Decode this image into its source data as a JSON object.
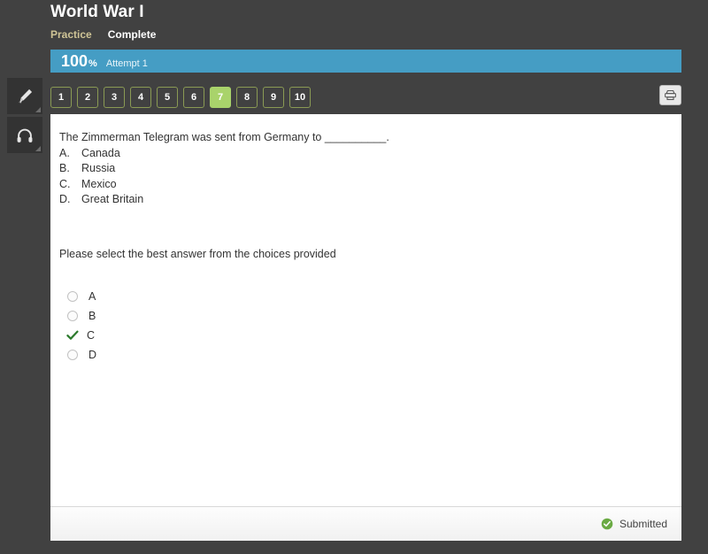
{
  "header": {
    "course_title": "World War I",
    "nav": {
      "practice_label": "Practice",
      "complete_label": "Complete"
    },
    "progress": {
      "score": "100",
      "percent_symbol": "%",
      "attempt_label": "Attempt 1"
    }
  },
  "tools": {
    "highlighter_icon": "highlighter-icon",
    "headphones_icon": "headphones-icon"
  },
  "question_nav": {
    "numbers": [
      "1",
      "2",
      "3",
      "4",
      "5",
      "6",
      "7",
      "8",
      "9",
      "10"
    ],
    "active_index": 6,
    "print_icon": "printer-icon"
  },
  "question": {
    "stem": "The Zimmerman Telegram was sent from Germany to __________.",
    "choices": [
      {
        "letter": "A.",
        "text": "Canada"
      },
      {
        "letter": "B.",
        "text": "Russia"
      },
      {
        "letter": "C.",
        "text": "Mexico"
      },
      {
        "letter": "D.",
        "text": "Great Britain"
      }
    ],
    "prompt": "Please select the best answer from the choices provided",
    "answers": [
      {
        "label": "A",
        "selected": false
      },
      {
        "label": "B",
        "selected": false
      },
      {
        "label": "C",
        "selected": true
      },
      {
        "label": "D",
        "selected": false
      }
    ]
  },
  "footer": {
    "status_label": "Submitted",
    "status_icon": "check-circle-icon"
  },
  "colors": {
    "background": "#414141",
    "progress_bar": "#459dc4",
    "active_number": "#a9d36b",
    "number_border": "#8a9a54",
    "practice_text": "#cfc496",
    "check_green": "#2c7a2c",
    "submitted_green": "#6aaa43"
  }
}
